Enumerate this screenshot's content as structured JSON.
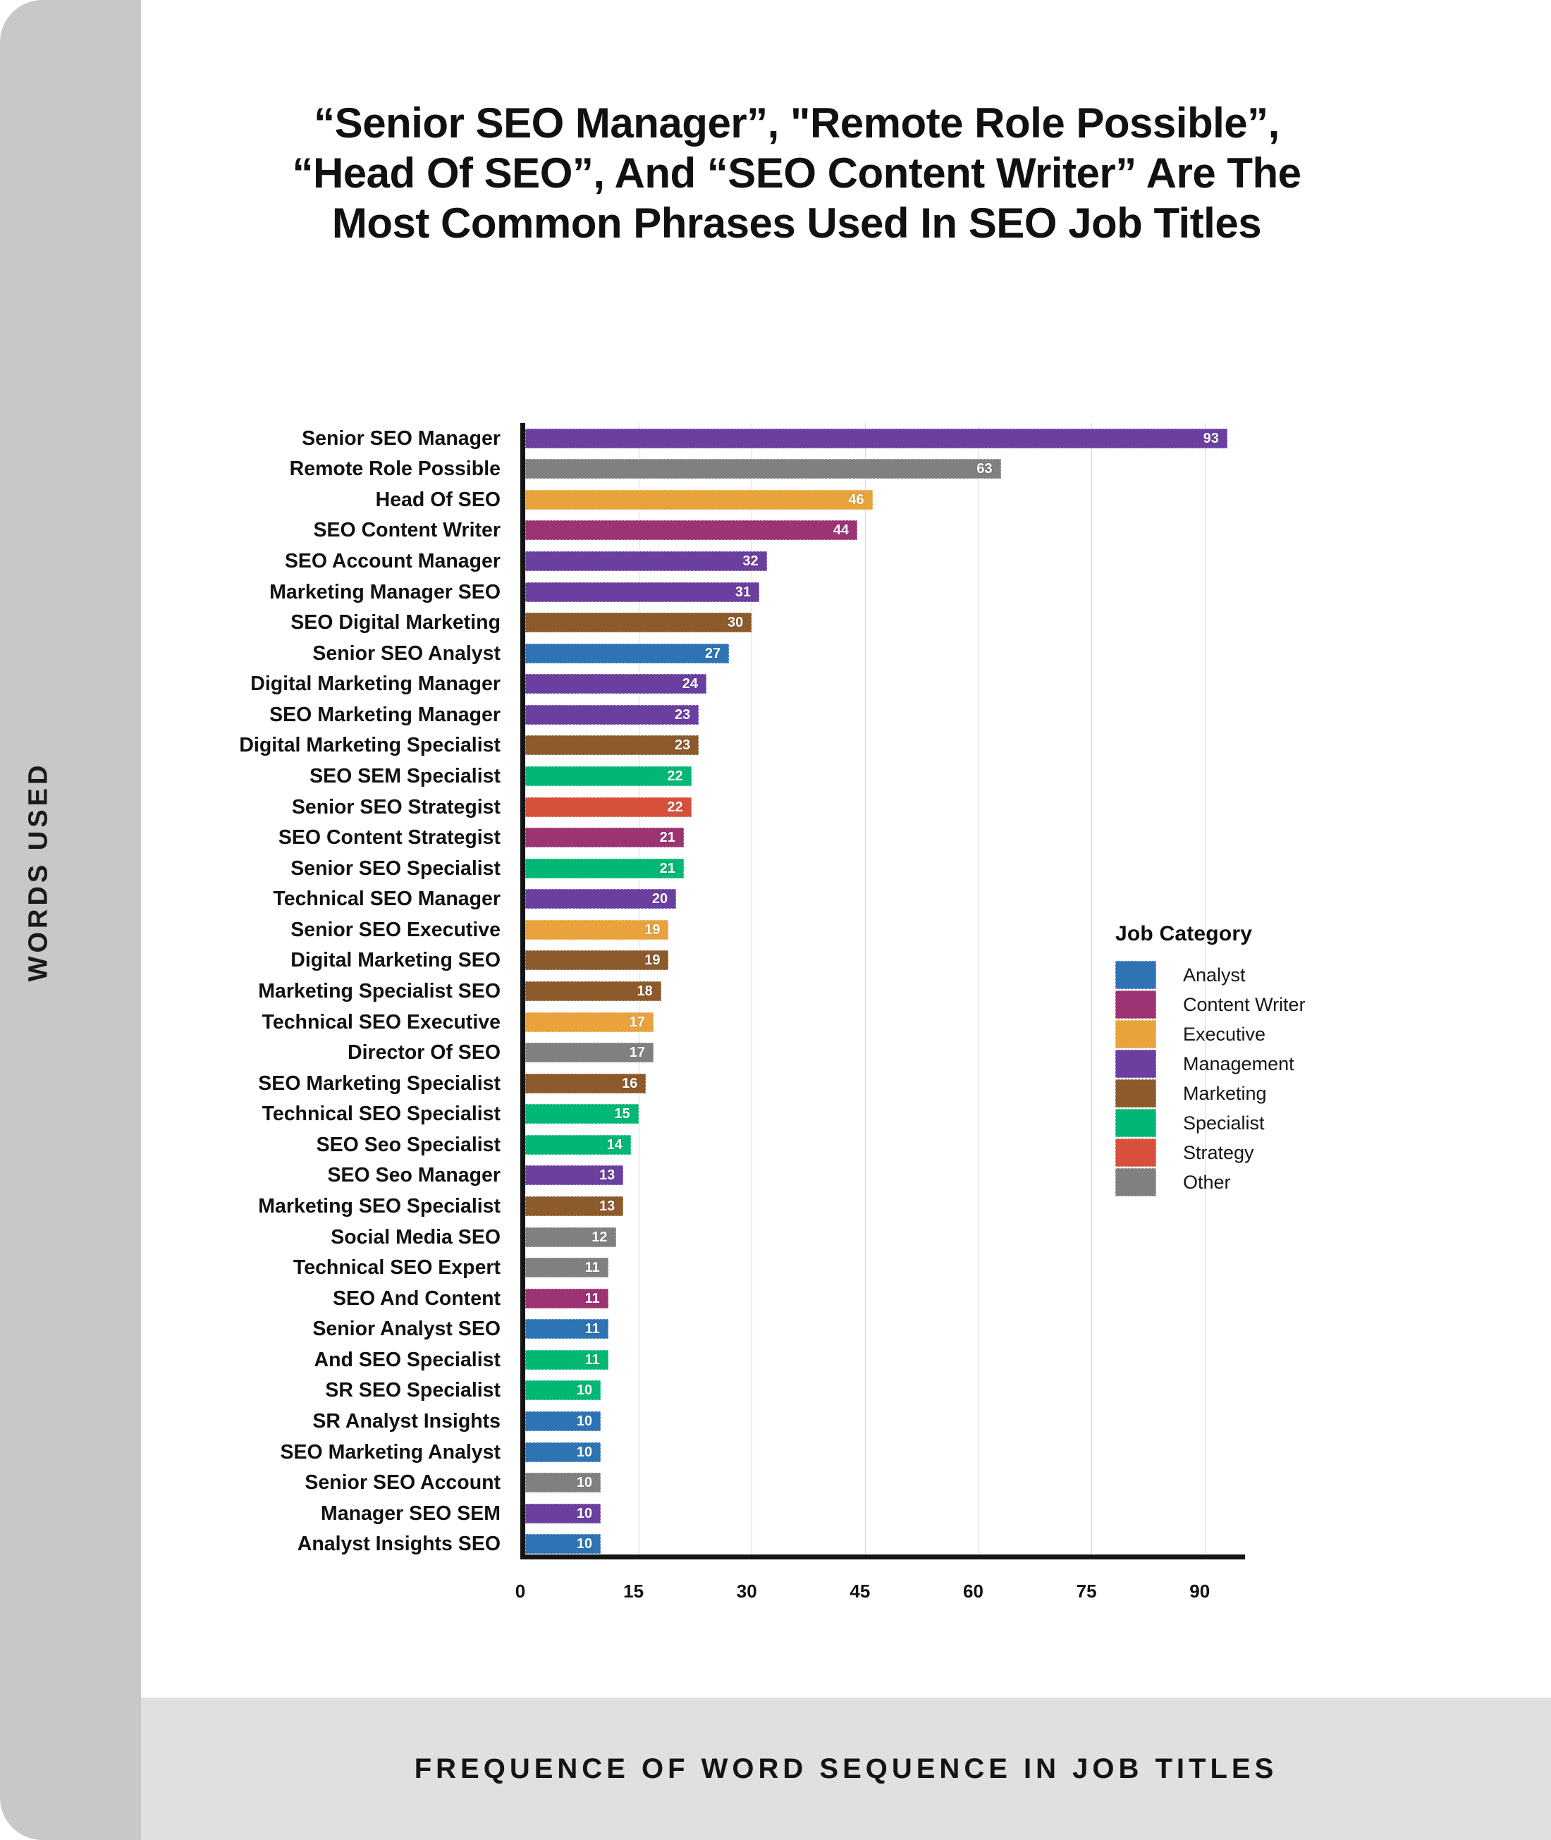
{
  "title": "“Senior SEO Manager”, \"Remote Role Possible”, “Head Of SEO”, And “SEO Content Writer” Are The Most Common Phrases Used In SEO Job Titles",
  "axis_label_vertical": "WORDS USED",
  "footer_label": "FREQUENCE OF WORD SEQUENCE IN JOB TITLES",
  "legend": {
    "title": "Job Category",
    "items": [
      {
        "label": "Analyst",
        "color": "#2e74b5"
      },
      {
        "label": "Content Writer",
        "color": "#9c3373"
      },
      {
        "label": "Executive",
        "color": "#e8a33d"
      },
      {
        "label": "Management",
        "color": "#6b3fa0"
      },
      {
        "label": "Marketing",
        "color": "#8c5a2b"
      },
      {
        "label": "Specialist",
        "color": "#00b874"
      },
      {
        "label": "Strategy",
        "color": "#d6503c"
      },
      {
        "label": "Other",
        "color": "#808080"
      }
    ]
  },
  "chart_data": {
    "type": "bar",
    "orientation": "horizontal",
    "title": "“Senior SEO Manager”, \"Remote Role Possible”, “Head Of SEO”, And “SEO Content Writer” Are The Most Common Phrases Used In SEO Job Titles",
    "xlabel": "FREQUENCE OF WORD SEQUENCE IN JOB TITLES",
    "ylabel": "WORDS USED",
    "xlim": [
      0,
      96
    ],
    "xticks": [
      0,
      15,
      30,
      45,
      60,
      75,
      90
    ],
    "grid": "vertical",
    "legend_position": "inside-right",
    "legend_title": "Job Category",
    "categories": [
      "Senior SEO Manager",
      "Remote Role Possible",
      "Head Of SEO",
      "SEO Content Writer",
      "SEO Account Manager",
      "Marketing Manager SEO",
      "SEO Digital Marketing",
      "Senior SEO Analyst",
      "Digital Marketing Manager",
      "SEO Marketing Manager",
      "Digital Marketing Specialist",
      "SEO SEM Specialist",
      "Senior SEO Strategist",
      "SEO Content Strategist",
      "Senior SEO Specialist",
      "Technical SEO Manager",
      "Senior SEO Executive",
      "Digital Marketing SEO",
      "Marketing Specialist SEO",
      "Technical SEO Executive",
      "Director Of SEO",
      "SEO Marketing Specialist",
      "Technical SEO Specialist",
      "SEO Seo Specialist",
      "SEO Seo Manager",
      "Marketing SEO Specialist",
      "Social Media SEO",
      "Technical SEO Expert",
      "SEO And Content",
      "Senior Analyst SEO",
      "And SEO Specialist",
      "SR SEO Specialist",
      "SR Analyst Insights",
      "SEO Marketing Analyst",
      "Senior SEO Account",
      "Manager SEO SEM",
      "Analyst Insights SEO"
    ],
    "values": [
      93,
      63,
      46,
      44,
      32,
      31,
      30,
      27,
      24,
      23,
      23,
      22,
      22,
      21,
      21,
      20,
      19,
      19,
      18,
      17,
      17,
      16,
      15,
      14,
      13,
      13,
      12,
      11,
      11,
      11,
      11,
      10,
      10,
      10,
      10,
      10,
      10
    ],
    "category_of_bar": [
      "Management",
      "Other",
      "Executive",
      "Content Writer",
      "Management",
      "Management",
      "Marketing",
      "Analyst",
      "Management",
      "Management",
      "Marketing",
      "Specialist",
      "Strategy",
      "Content Writer",
      "Specialist",
      "Management",
      "Executive",
      "Marketing",
      "Marketing",
      "Executive",
      "Other",
      "Marketing",
      "Specialist",
      "Specialist",
      "Management",
      "Marketing",
      "Other",
      "Other",
      "Content Writer",
      "Analyst",
      "Specialist",
      "Specialist",
      "Analyst",
      "Analyst",
      "Other",
      "Management",
      "Analyst"
    ],
    "colors": [
      "#6b3fa0",
      "#808080",
      "#e8a33d",
      "#9c3373",
      "#6b3fa0",
      "#6b3fa0",
      "#8c5a2b",
      "#2e74b5",
      "#6b3fa0",
      "#6b3fa0",
      "#8c5a2b",
      "#00b874",
      "#d6503c",
      "#9c3373",
      "#00b874",
      "#6b3fa0",
      "#e8a33d",
      "#8c5a2b",
      "#8c5a2b",
      "#e8a33d",
      "#808080",
      "#8c5a2b",
      "#00b874",
      "#00b874",
      "#6b3fa0",
      "#8c5a2b",
      "#808080",
      "#808080",
      "#9c3373",
      "#2e74b5",
      "#00b874",
      "#00b874",
      "#2e74b5",
      "#2e74b5",
      "#808080",
      "#6b3fa0",
      "#2e74b5"
    ]
  }
}
